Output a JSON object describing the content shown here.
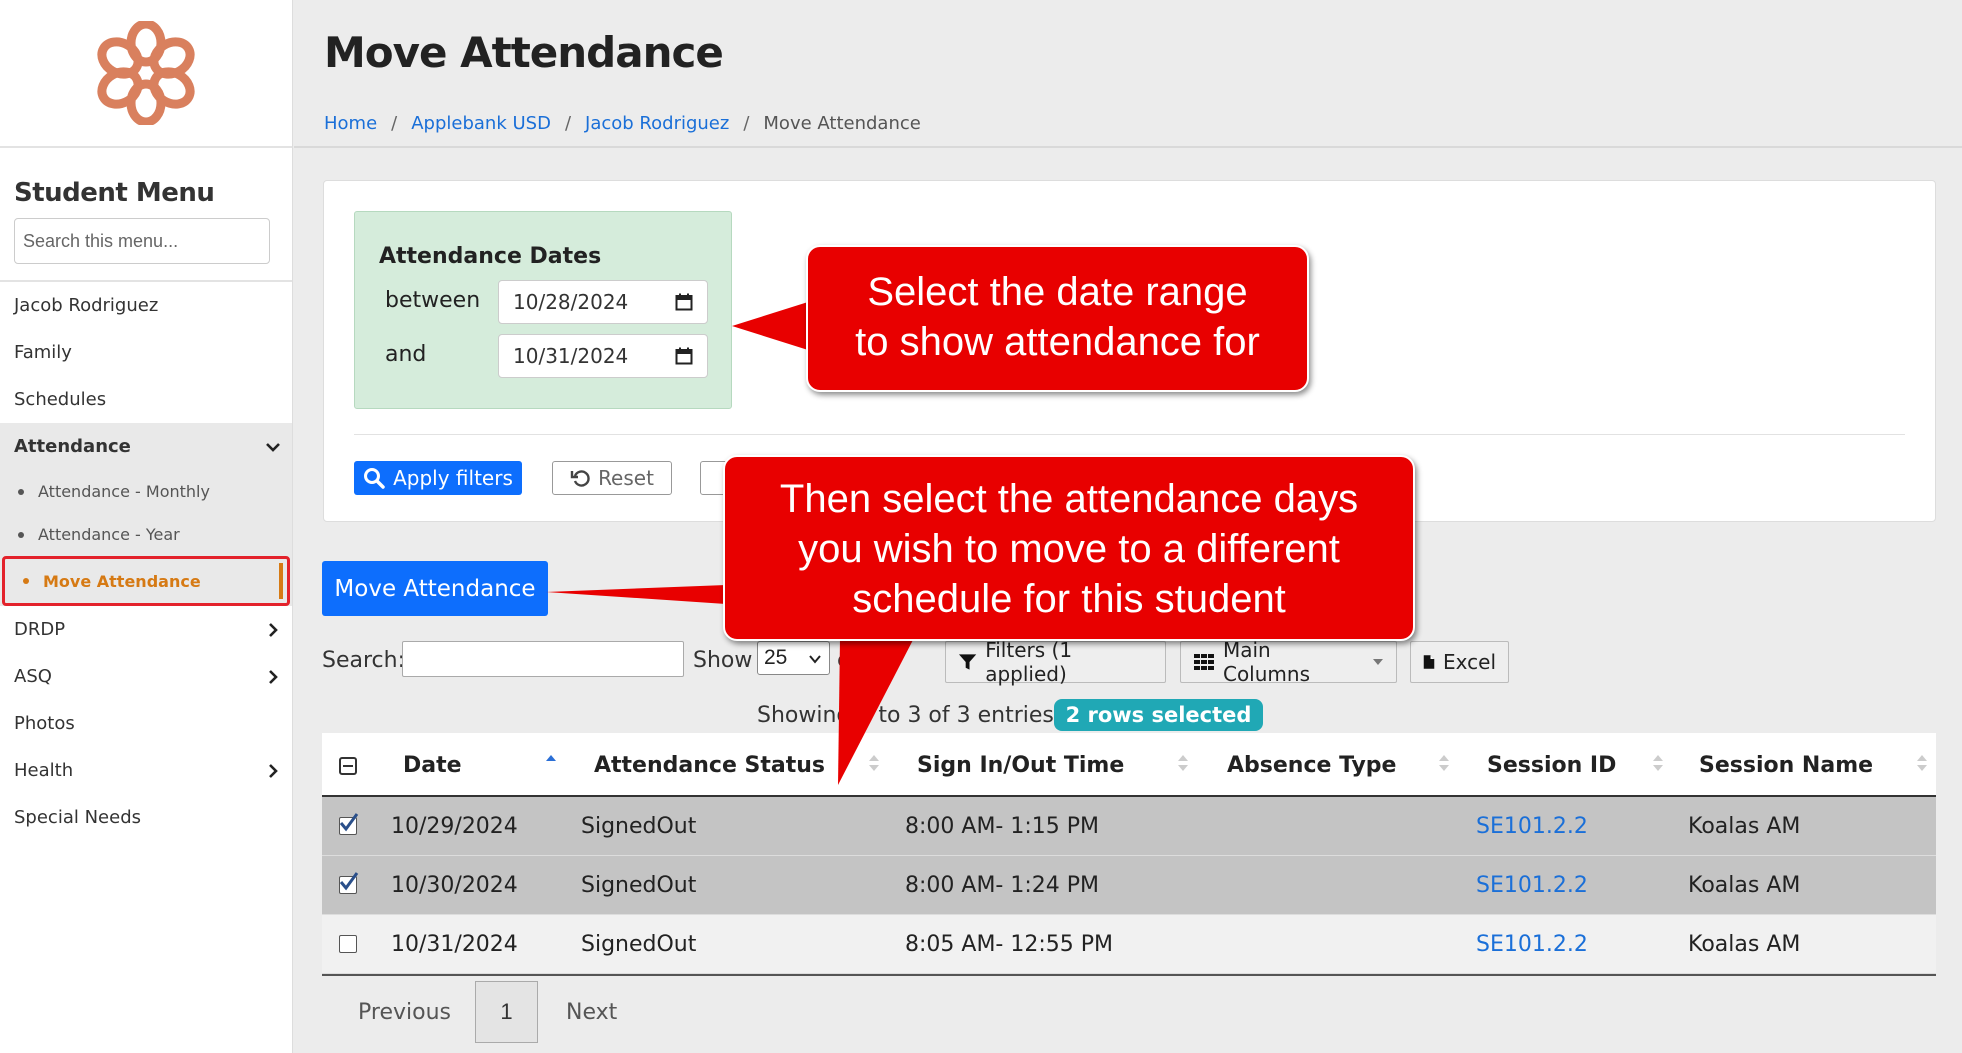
{
  "header": {
    "title": "Move Attendance",
    "breadcrumb": [
      "Home",
      "Applebank USD",
      "Jacob Rodriguez",
      "Move Attendance"
    ]
  },
  "sidebar": {
    "title": "Student Menu",
    "search_placeholder": "Search this menu...",
    "items": [
      {
        "label": "Jacob Rodriguez"
      },
      {
        "label": "Family"
      },
      {
        "label": "Schedules"
      },
      {
        "label": "Attendance"
      },
      {
        "label": "DRDP"
      },
      {
        "label": "ASQ"
      },
      {
        "label": "Photos"
      },
      {
        "label": "Health"
      },
      {
        "label": "Special Needs"
      }
    ],
    "attendance_sub": [
      "Attendance - Monthly",
      "Attendance - Year",
      "Move Attendance"
    ]
  },
  "filters": {
    "title": "Attendance Dates",
    "between_label": "between",
    "and_label": "and",
    "start_date": "10/28/2024",
    "end_date": "10/31/2024",
    "apply_label": "Apply filters",
    "reset_label": "Reset"
  },
  "actions": {
    "move_label": "Move Attendance"
  },
  "toolbar": {
    "search_label": "Search:",
    "show_label": "Show",
    "page_size": "25",
    "entries_label": "entri",
    "filters_label": "Filters (1 applied)",
    "columns_label": "Main Columns",
    "excel_label": "Excel",
    "showing_text": "Showing 1 to 3 of 3 entries",
    "rows_selected": "2 rows selected"
  },
  "table": {
    "columns": [
      "Date",
      "Attendance Status",
      "Sign In/Out Time",
      "Absence Type",
      "Session ID",
      "Session Name"
    ],
    "rows": [
      {
        "selected": true,
        "date": "10/29/2024",
        "status": "SignedOut",
        "time": "8:00 AM- 1:15 PM",
        "absence": "",
        "session_id": "SE101.2.2",
        "session_name": "Koalas AM"
      },
      {
        "selected": true,
        "date": "10/30/2024",
        "status": "SignedOut",
        "time": "8:00 AM- 1:24 PM",
        "absence": "",
        "session_id": "SE101.2.2",
        "session_name": "Koalas AM"
      },
      {
        "selected": false,
        "date": "10/31/2024",
        "status": "SignedOut",
        "time": "8:05 AM- 12:55 PM",
        "absence": "",
        "session_id": "SE101.2.2",
        "session_name": "Koalas AM"
      }
    ]
  },
  "pagination": {
    "previous": "Previous",
    "page": "1",
    "next": "Next"
  },
  "callouts": {
    "top": [
      "Select the date range",
      "to show attendance for"
    ],
    "bottom": [
      "Then select the attendance days",
      "you wish to move to a different",
      "schedule for this student"
    ]
  },
  "colors": {
    "primary": "#0d6efd",
    "accent_orange": "#d67a14",
    "callout_red": "#e80000",
    "badge_teal": "#20a8b5",
    "dates_bg": "#d5ecdb"
  }
}
